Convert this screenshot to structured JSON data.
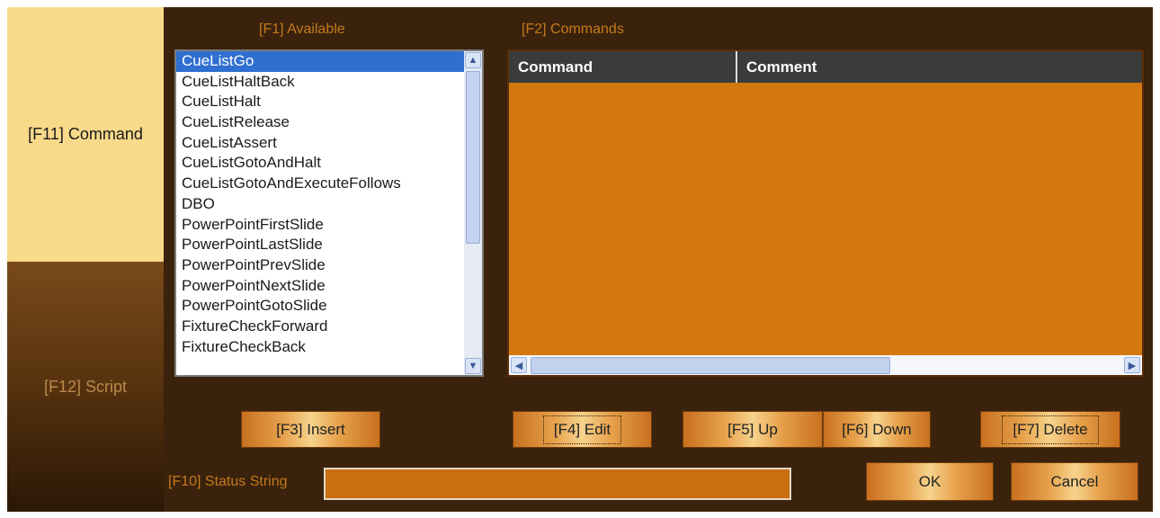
{
  "tabs": {
    "command": "[F11] Command",
    "script": "[F12] Script"
  },
  "available": {
    "label": "[F1] Available",
    "items": [
      "CueListGo",
      "CueListHaltBack",
      "CueListHalt",
      "CueListRelease",
      "CueListAssert",
      "CueListGotoAndHalt",
      "CueListGotoAndExecuteFollows",
      "DBO",
      "PowerPointFirstSlide",
      "PowerPointLastSlide",
      "PowerPointPrevSlide",
      "PowerPointNextSlide",
      "PowerPointGotoSlide",
      "FixtureCheckForward",
      "FixtureCheckBack"
    ],
    "selected_index": 0
  },
  "commands": {
    "label": "[F2] Commands",
    "columns": [
      "Command",
      "Comment"
    ],
    "rows": []
  },
  "buttons": {
    "insert": "[F3] Insert",
    "edit": "[F4] Edit",
    "up": "[F5] Up",
    "down": "[F6] Down",
    "delete": "[F7] Delete",
    "ok": "OK",
    "cancel": "Cancel"
  },
  "status": {
    "label": "[F10] Status String",
    "value": ""
  },
  "icons": {
    "scroll_up": "chevron-up-icon",
    "scroll_down": "chevron-down-icon",
    "scroll_left": "chevron-left-icon",
    "scroll_right": "chevron-right-icon"
  },
  "colors": {
    "accent": "#d47910",
    "tab_active": "#f9d98a",
    "selection": "#2f6fd0",
    "label_text": "#c47a1c"
  }
}
